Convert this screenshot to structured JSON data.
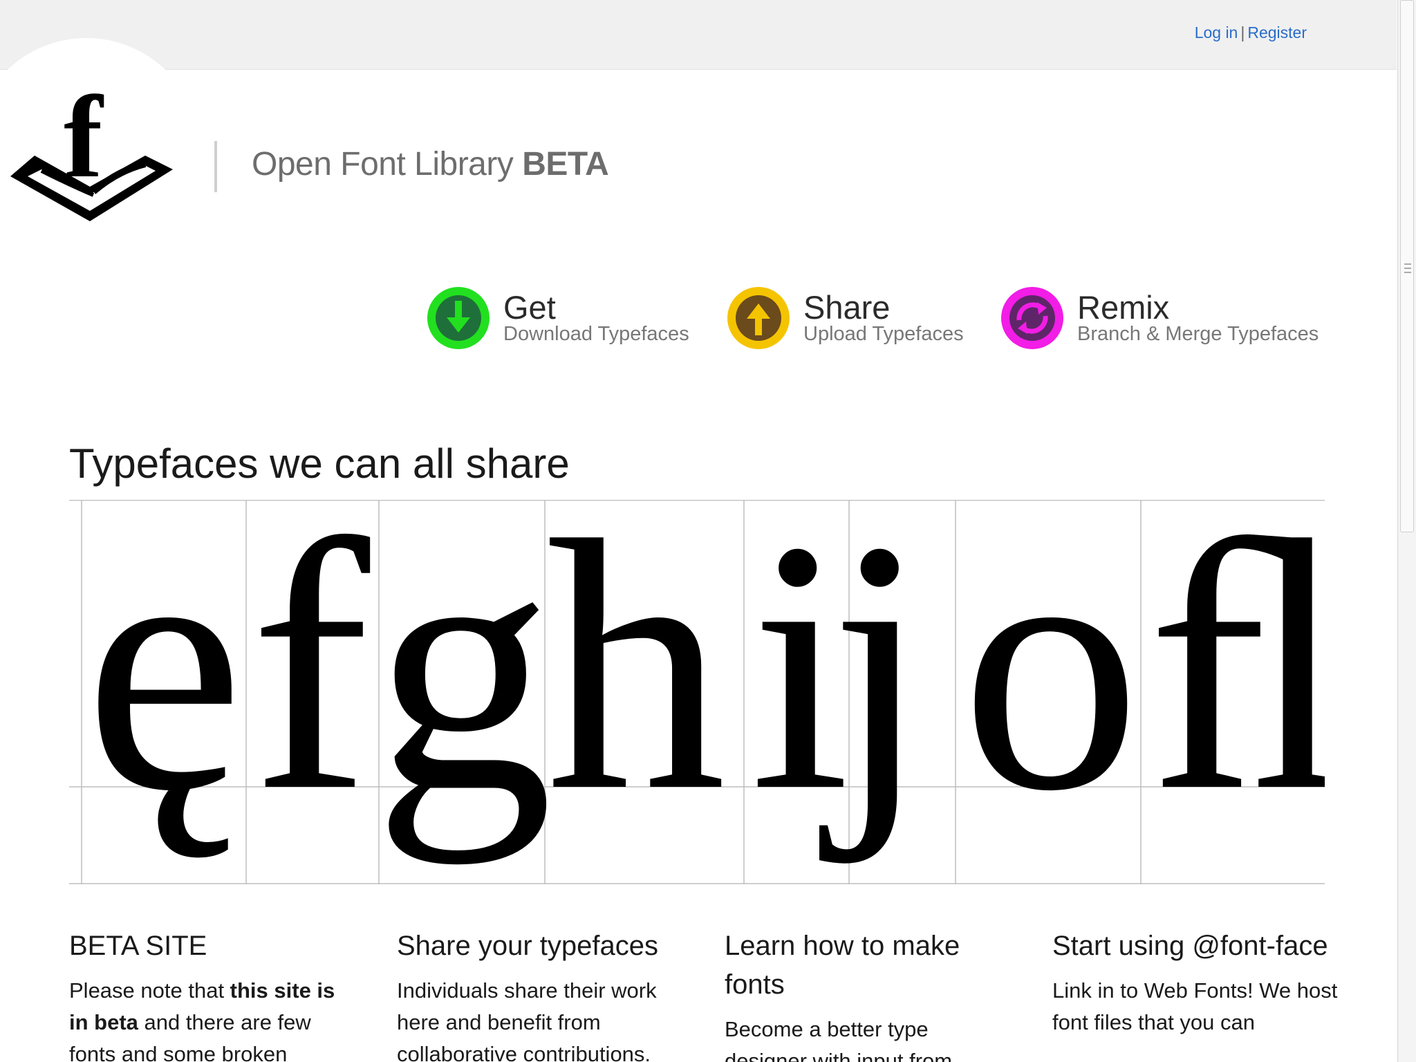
{
  "header": {
    "login_label": "Log in",
    "separator": "|",
    "register_label": "Register"
  },
  "site": {
    "title_prefix": "Open Font Library",
    "title_badge": "BETA"
  },
  "actions": [
    {
      "label": "Get",
      "sublabel": "Download Typefaces",
      "icon": "download-arrow-icon",
      "color": "#22e01f",
      "inner": "#1f6f3a"
    },
    {
      "label": "Share",
      "sublabel": "Upload Typefaces",
      "icon": "upload-arrow-icon",
      "color": "#f5c400",
      "inner": "#6b4a1c"
    },
    {
      "label": "Remix",
      "sublabel": "Branch & Merge Typefaces",
      "icon": "remix-arrows-icon",
      "color": "#f21de6",
      "inner": "#5e2668"
    }
  ],
  "main": {
    "headline": "Typefaces we can all share",
    "specimen_glyphs": [
      "ę",
      "f",
      "g",
      "h",
      "i",
      "j",
      "o",
      "ﬂ"
    ]
  },
  "columns": [
    {
      "heading": "BETA SITE",
      "body_before": "Please note that ",
      "body_bold": "this site is in beta",
      "body_after": " and there are few fonts and some broken"
    },
    {
      "heading": "Share your typefaces",
      "body_before": "Individuals share their work here and benefit from collaborative contributions.",
      "body_bold": "",
      "body_after": ""
    },
    {
      "heading": "Learn how to make fonts",
      "body_before": "Become a better type designer with input from",
      "body_bold": "",
      "body_after": ""
    },
    {
      "heading": "Start using @font-face",
      "body_before": "Link in to Web Fonts! We host font files that you can",
      "body_bold": "",
      "body_after": ""
    }
  ]
}
